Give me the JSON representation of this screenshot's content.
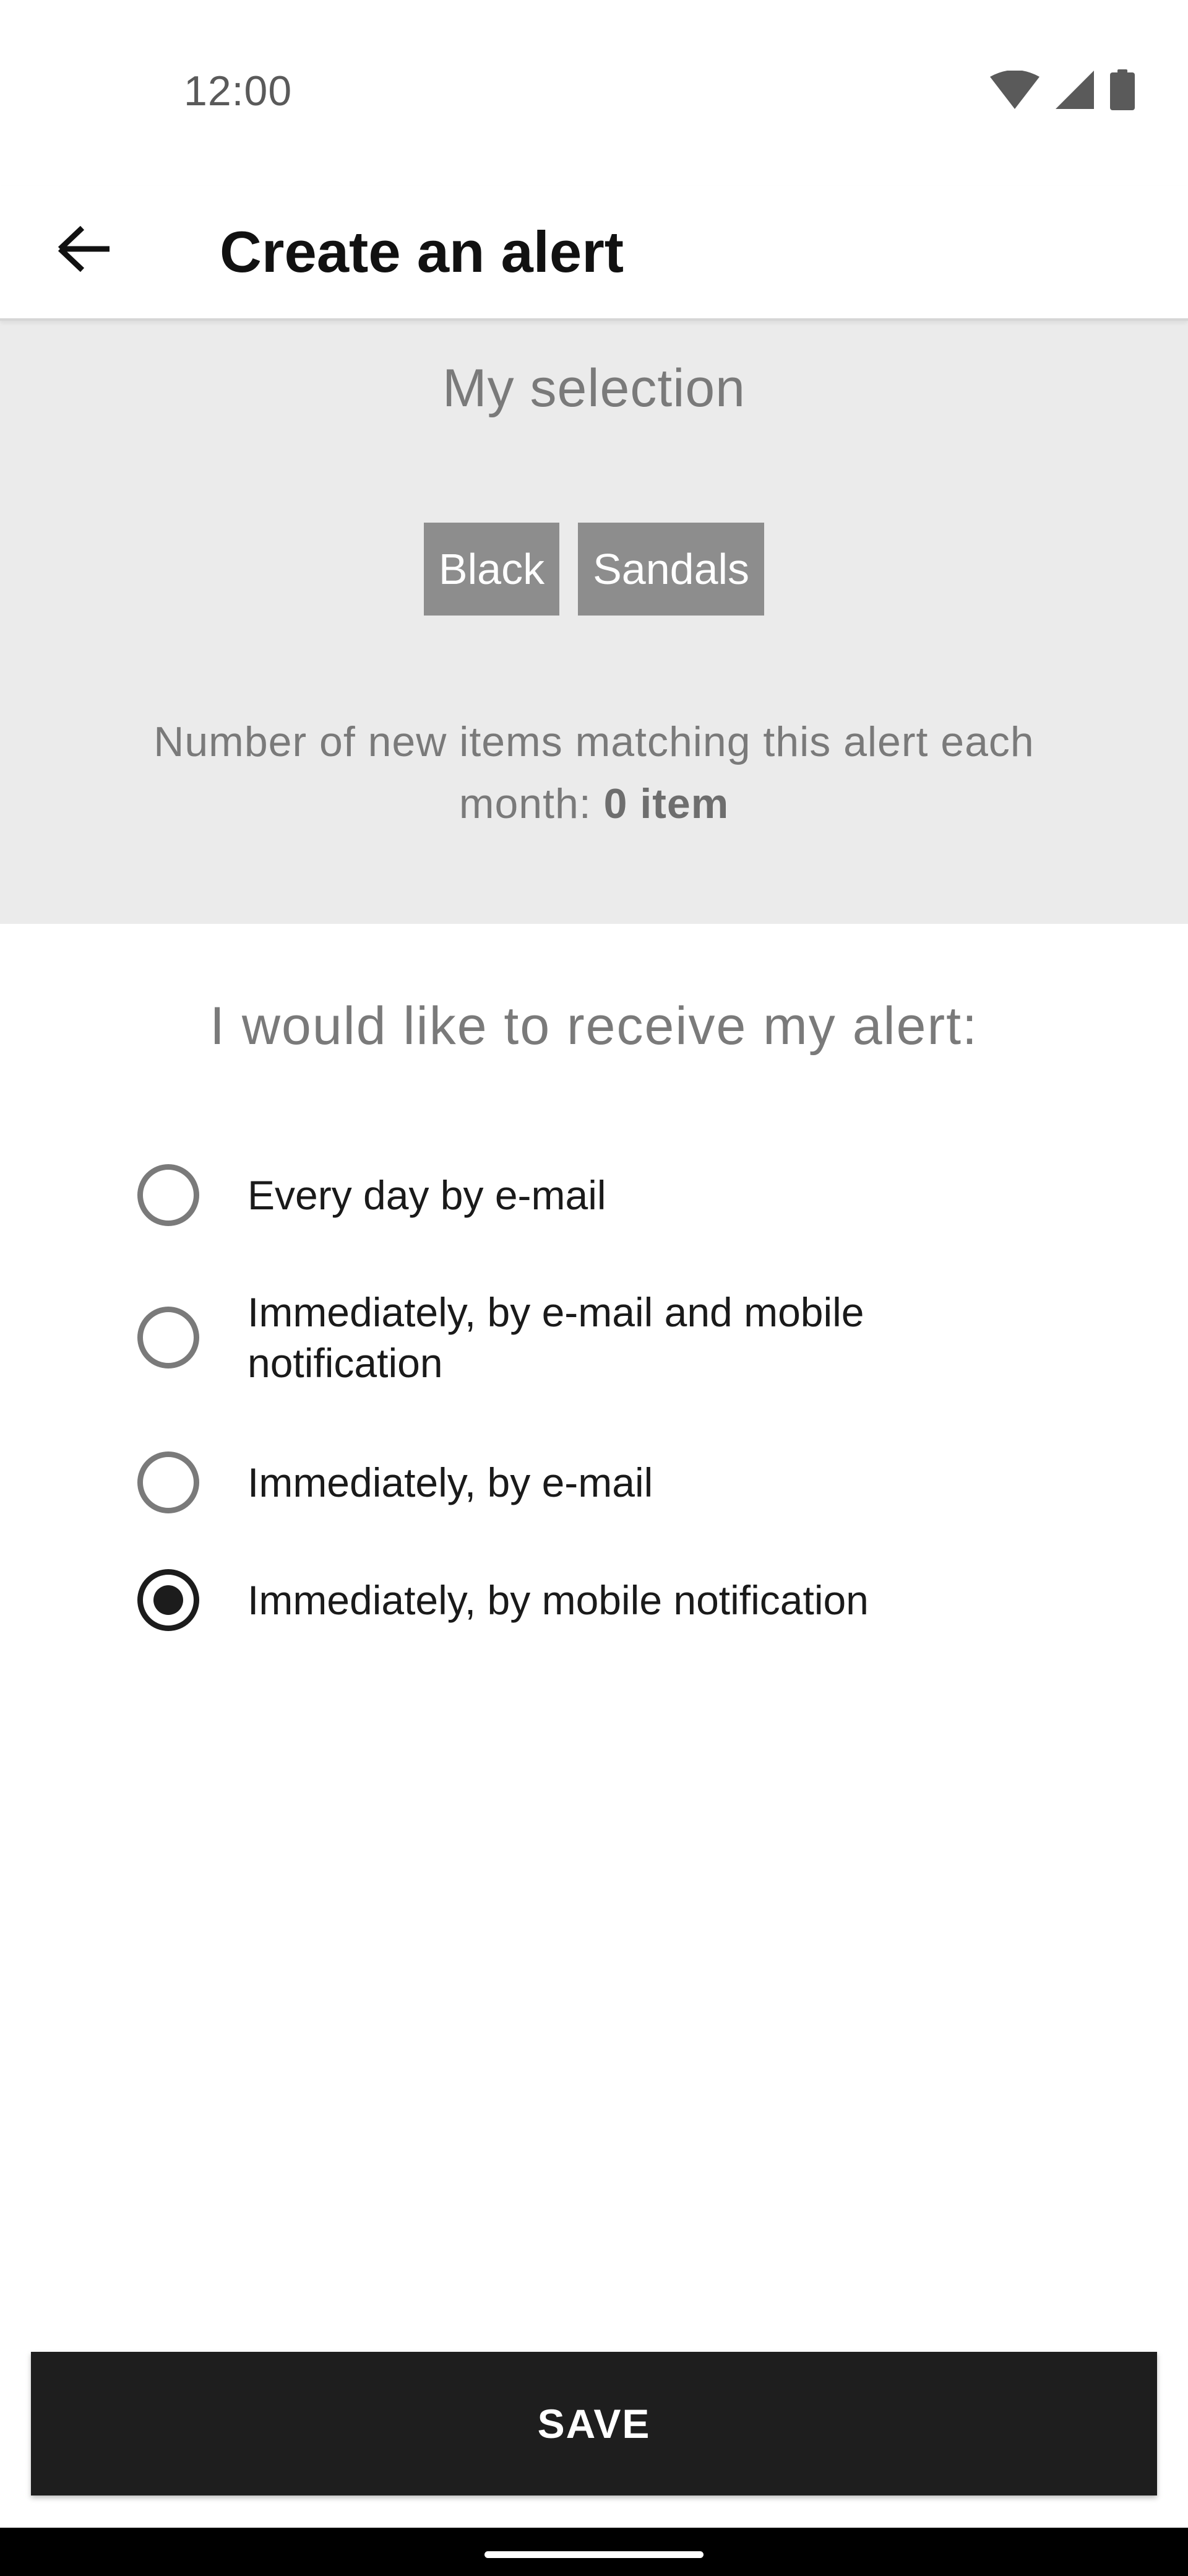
{
  "status_bar": {
    "time": "12:00",
    "icons": [
      "wifi-icon",
      "cellular-signal-icon",
      "battery-icon"
    ]
  },
  "app_bar": {
    "back_icon": "arrow-left-icon",
    "title": "Create an alert"
  },
  "selection": {
    "heading": "My selection",
    "chips": [
      "Black",
      "Sandals"
    ],
    "match_text_prefix": "Number of new items matching this alert each month:",
    "match_count": "0 item"
  },
  "delivery": {
    "heading": "I would like to receive my alert:",
    "options": [
      {
        "label": "Every day by e-mail",
        "selected": false
      },
      {
        "label": "Immediately, by e-mail and mobile notification",
        "selected": false
      },
      {
        "label": "Immediately, by e-mail",
        "selected": false
      },
      {
        "label": "Immediately, by mobile notification",
        "selected": true
      }
    ]
  },
  "actions": {
    "save_label": "SAVE"
  },
  "colors": {
    "panel_background": "#ebebeb",
    "chip_background": "#8d8d8d",
    "button_background": "#1e1e1e",
    "muted_text": "#7a7a7a"
  }
}
